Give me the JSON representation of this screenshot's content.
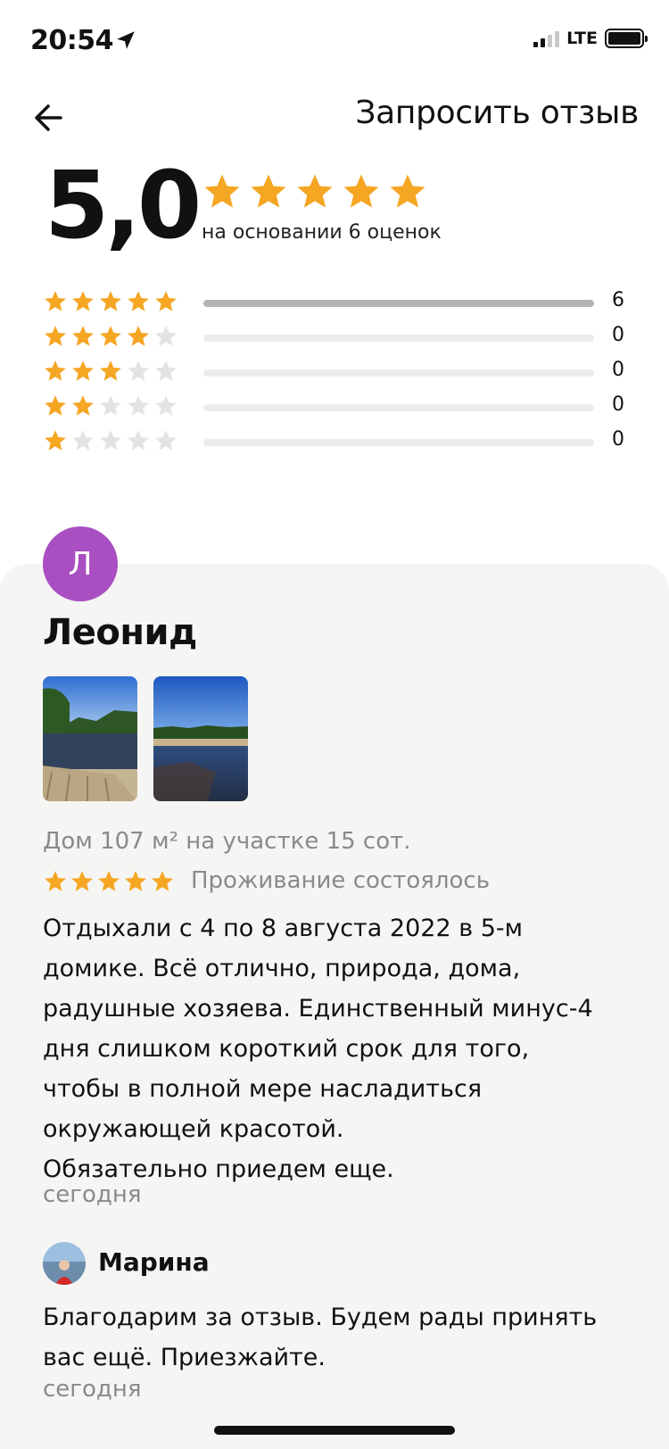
{
  "status_bar": {
    "time": "20:54",
    "network": "LTE",
    "icons": [
      "location-arrow-icon",
      "signal-icon",
      "battery-icon"
    ]
  },
  "header": {
    "back_icon": "arrow-left-icon",
    "request_review_label": "Запросить отзыв"
  },
  "rating_summary": {
    "average": "5,0",
    "stars": 5,
    "based_on": "на основании 6 оценок",
    "star_color": "#f5a623",
    "empty_star_color": "#e3e3e3"
  },
  "histogram": [
    {
      "stars": 5,
      "count": "6",
      "share": 1
    },
    {
      "stars": 4,
      "count": "0",
      "share": 0
    },
    {
      "stars": 3,
      "count": "0",
      "share": 0
    },
    {
      "stars": 2,
      "count": "0",
      "share": 0
    },
    {
      "stars": 1,
      "count": "0",
      "share": 0
    }
  ],
  "review": {
    "avatar_letter": "Л",
    "avatar_color": "#a94fc2",
    "author": "Леонид",
    "photos": [
      "lake-pier-photo",
      "lake-shore-photo"
    ],
    "property": "Дом 107 м² на участке 15 сот.",
    "rating": 5,
    "status": "Проживание состоялось",
    "text_lines": [
      "Отдыхали с 4 по 8 августа 2022 в 5-м",
      "домике. Всё отлично, природа, дома,",
      "радушные хозяева. Единственный минус-4",
      "дня слишком короткий срок для того,",
      "чтобы в полной мере насладиться",
      "окружающей красотой.",
      "Обязательно приедем еще."
    ],
    "date": "сегодня"
  },
  "reply": {
    "author": "Марина",
    "text_lines": [
      "Благодарим за отзыв. Будем рады принять",
      "вас ещё. Приезжайте."
    ],
    "date": "сегодня"
  }
}
